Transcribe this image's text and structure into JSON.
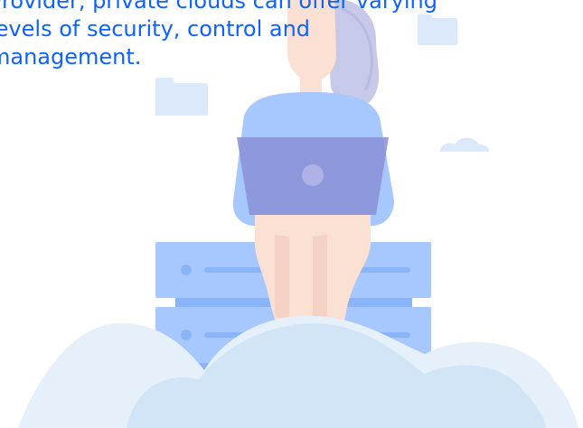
{
  "content": {
    "paragraph": "Provider, private clouds can offer varying\nlevels of security, control and\nmanagement."
  },
  "illustration": {
    "subject": "woman-with-laptop-sitting-on-server-stack-on-cloud",
    "icons": [
      "folder-icon",
      "folder-icon",
      "cloud-icon",
      "laptop-icon"
    ]
  },
  "colors": {
    "text": "#0f62fe",
    "cloud_light": "#e5f0fb",
    "cloud_mid": "#d2e5f7",
    "server": "#a6c8ff",
    "server_dark": "#8ab4f8",
    "shirt": "#a6c8ff",
    "laptop": "#8a8fd6",
    "skin": "#fbe0d4",
    "hair": "#c7c9e8",
    "folder": "#dbe9fa"
  }
}
